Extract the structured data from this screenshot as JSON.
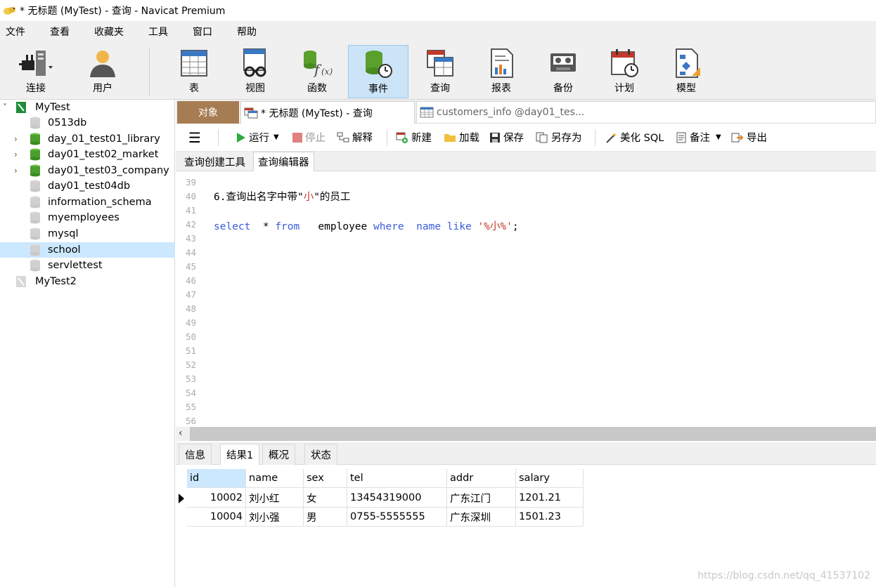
{
  "window": {
    "title": "* 无标题 (MyTest) - 查询 - Navicat Premium"
  },
  "menu": [
    "文件",
    "查看",
    "收藏夹",
    "工具",
    "窗口",
    "帮助"
  ],
  "toolbar": {
    "buttons": [
      {
        "label": "连接",
        "icon": "connection-icon"
      },
      {
        "label": "用户",
        "icon": "user-icon"
      },
      {
        "label": "表",
        "icon": "table-icon"
      },
      {
        "label": "视图",
        "icon": "view-icon"
      },
      {
        "label": "函数",
        "icon": "function-icon"
      },
      {
        "label": "事件",
        "icon": "event-icon",
        "active": true
      },
      {
        "label": "查询",
        "icon": "query-icon"
      },
      {
        "label": "报表",
        "icon": "report-icon"
      },
      {
        "label": "备份",
        "icon": "backup-icon"
      },
      {
        "label": "计划",
        "icon": "schedule-icon"
      },
      {
        "label": "模型",
        "icon": "model-icon"
      }
    ]
  },
  "sidebar": {
    "items": [
      {
        "label": "MyTest",
        "level": 0,
        "expanded": true,
        "type": "connection"
      },
      {
        "label": "0513db",
        "level": 1,
        "type": "db-closed"
      },
      {
        "label": "day_01_test01_library",
        "level": 1,
        "type": "db-open",
        "expandable": true
      },
      {
        "label": "day01_test02_market",
        "level": 1,
        "type": "db-open",
        "expandable": true
      },
      {
        "label": "day01_test03_company",
        "level": 1,
        "type": "db-open",
        "expandable": true
      },
      {
        "label": "day01_test04db",
        "level": 1,
        "type": "db-closed"
      },
      {
        "label": "information_schema",
        "level": 1,
        "type": "db-closed"
      },
      {
        "label": "myemployees",
        "level": 1,
        "type": "db-closed"
      },
      {
        "label": "mysql",
        "level": 1,
        "type": "db-closed"
      },
      {
        "label": "school",
        "level": 1,
        "type": "db-closed",
        "selected": true
      },
      {
        "label": "servlettest",
        "level": 1,
        "type": "db-closed"
      },
      {
        "label": "MyTest2",
        "level": 0,
        "type": "connection-off"
      }
    ]
  },
  "tabs": {
    "objects": "对象",
    "query": "* 无标题 (MyTest) - 查询",
    "customers": "customers_info @day01_tes..."
  },
  "query_toolbar": {
    "run": "运行",
    "stop": "停止",
    "explain": "解释",
    "new": "新建",
    "load": "加载",
    "save": "保存",
    "save_as": "另存为",
    "beautify": "美化 SQL",
    "comment": "备注",
    "export": "导出"
  },
  "subtabs": {
    "builder": "查询创建工具",
    "editor": "查询编辑器"
  },
  "editor": {
    "line_numbers": [
      "39",
      "40",
      "41",
      "42",
      "43",
      "44",
      "45",
      "46",
      "47",
      "48",
      "49",
      "50",
      "51",
      "52",
      "53",
      "54",
      "55",
      "56"
    ],
    "line40_pre": "6.查询出名字中带\"",
    "line40_mid": "小",
    "line40_post": "\"的员工",
    "line42": {
      "kw1": "select",
      "t1": "  * ",
      "kw2": "from",
      "t2": "   employee ",
      "kw3": "where",
      "t3": "  ",
      "kw4": "name",
      "t4": " ",
      "kw5": "like",
      "t5": " ",
      "str": "'%小%'",
      "end": ";"
    }
  },
  "result_tabs": [
    "信息",
    "结果1",
    "概况",
    "状态"
  ],
  "result": {
    "columns": [
      "id",
      "name",
      "sex",
      "tel",
      "addr",
      "salary"
    ],
    "rows": [
      [
        "10002",
        "刘小红",
        "女",
        "13454319000",
        "广东江门",
        "1201.21"
      ],
      [
        "10004",
        "刘小强",
        "男",
        "0755-5555555",
        "广东深圳",
        "1501.23"
      ]
    ]
  },
  "watermark": "https://blog.csdn.net/qq_41537102"
}
